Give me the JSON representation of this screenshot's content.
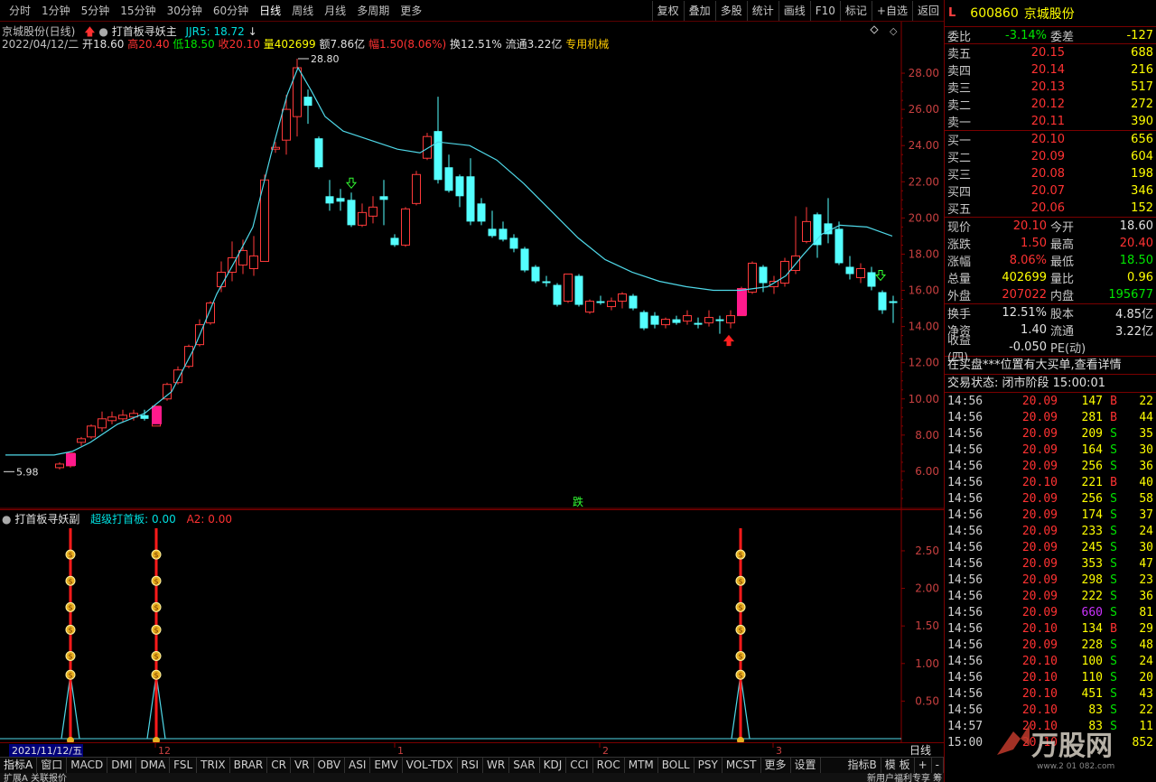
{
  "toolbar": {
    "periods": [
      "分时",
      "1分钟",
      "5分钟",
      "15分钟",
      "30分钟",
      "60分钟",
      "日线",
      "周线",
      "月线",
      "多周期",
      "更多"
    ],
    "active_period": "日线",
    "right_tools": [
      "复权",
      "叠加",
      "多股",
      "统计",
      "画线",
      "F10",
      "标记",
      "+自选",
      "返回"
    ]
  },
  "chart_header": {
    "stock_label": "京城股份(日线)",
    "indicator_name": "打首板寻妖主",
    "jjr5": "JJR5: 18.72",
    "date": "2022/04/12/二",
    "open": "开18.60",
    "high": "高20.40",
    "low": "低18.50",
    "close": "收20.10",
    "volume": "量402699",
    "amount": "额7.86亿",
    "change_pct": "幅1.50(8.06%)",
    "turnover": "换12.51%",
    "float_cap": "流通3.22亿",
    "sector": "专用机械"
  },
  "main_chart": {
    "y_ticks": [
      "28.00",
      "26.00",
      "24.00",
      "22.00",
      "20.00",
      "18.00",
      "16.00",
      "14.00",
      "12.00",
      "10.00",
      "8.00",
      "6.00"
    ],
    "peak_label": "28.80",
    "low_label": "5.98",
    "annotation": "跌"
  },
  "sub_chart": {
    "title": "打首板寻妖副",
    "series1": "超级打首板: 0.00",
    "series2": "A2: 0.00",
    "y_ticks": [
      "2.50",
      "2.00",
      "1.50",
      "1.00",
      "0.50"
    ]
  },
  "x_axis": {
    "cursor_date": "2021/11/12/五",
    "labels": [
      "12",
      "1",
      "2",
      "3"
    ],
    "period_label": "日线"
  },
  "indicator_tabs": [
    "指标A",
    "窗口",
    "MACD",
    "DMI",
    "DMA",
    "FSL",
    "TRIX",
    "BRAR",
    "CR",
    "VR",
    "OBV",
    "ASI",
    "EMV",
    "VOL-TDX",
    "RSI",
    "WR",
    "SAR",
    "KDJ",
    "CCI",
    "ROC",
    "MTM",
    "BOLL",
    "PSY",
    "MCST",
    "更多",
    "设置"
  ],
  "indicator_tabs_right": [
    "指标B",
    "模 板",
    "+",
    "-"
  ],
  "bottom_bar": {
    "left": "扩展A  关联报价",
    "right": "新用户福利专享  筹  价  细  势  联  值  主"
  },
  "quote": {
    "flag": "L",
    "code": "600860",
    "name": "京城股份",
    "webi_label": "委比",
    "webi_value": "-3.14%",
    "weicha_label": "委差",
    "weicha_value": "-127",
    "asks": [
      {
        "label": "卖五",
        "price": "20.15",
        "vol": "688"
      },
      {
        "label": "卖四",
        "price": "20.14",
        "vol": "216"
      },
      {
        "label": "卖三",
        "price": "20.13",
        "vol": "517"
      },
      {
        "label": "卖二",
        "price": "20.12",
        "vol": "272"
      },
      {
        "label": "卖一",
        "price": "20.11",
        "vol": "390"
      }
    ],
    "bids": [
      {
        "label": "买一",
        "price": "20.10",
        "vol": "656"
      },
      {
        "label": "买二",
        "price": "20.09",
        "vol": "604"
      },
      {
        "label": "买三",
        "price": "20.08",
        "vol": "198"
      },
      {
        "label": "买四",
        "price": "20.07",
        "vol": "346"
      },
      {
        "label": "买五",
        "price": "20.06",
        "vol": "152"
      }
    ],
    "stats1": [
      {
        "k1": "现价",
        "v1": "20.10",
        "c1": "red",
        "k2": "今开",
        "v2": "18.60",
        "c2": "white"
      },
      {
        "k1": "涨跌",
        "v1": "1.50",
        "c1": "red",
        "k2": "最高",
        "v2": "20.40",
        "c2": "red"
      },
      {
        "k1": "涨幅",
        "v1": "8.06%",
        "c1": "red",
        "k2": "最低",
        "v2": "18.50",
        "c2": "green"
      },
      {
        "k1": "总量",
        "v1": "402699",
        "c1": "yellow",
        "k2": "量比",
        "v2": "0.96",
        "c2": "yellow"
      },
      {
        "k1": "外盘",
        "v1": "207022",
        "c1": "red",
        "k2": "内盘",
        "v2": "195677",
        "c2": "green"
      }
    ],
    "stats2": [
      {
        "k1": "换手",
        "v1": "12.51%",
        "c1": "white",
        "k2": "股本",
        "v2": "4.85亿",
        "c2": "white"
      },
      {
        "k1": "净资",
        "v1": "1.40",
        "c1": "white",
        "k2": "流通",
        "v2": "3.22亿",
        "c2": "white"
      },
      {
        "k1": "收益(四)",
        "v1": "-0.050",
        "c1": "white",
        "k2": "PE(动)",
        "v2": "",
        "c2": "white"
      }
    ],
    "message": "在买盘***位置有大买单,查看详情",
    "status": "交易状态: 闭市阶段 15:00:01",
    "ticks": [
      {
        "t": "14:56",
        "p": "20.09",
        "v": "147",
        "d": "B",
        "n": "22"
      },
      {
        "t": "14:56",
        "p": "20.09",
        "v": "281",
        "d": "B",
        "n": "44"
      },
      {
        "t": "14:56",
        "p": "20.09",
        "v": "209",
        "d": "S",
        "n": "35"
      },
      {
        "t": "14:56",
        "p": "20.09",
        "v": "164",
        "d": "S",
        "n": "30"
      },
      {
        "t": "14:56",
        "p": "20.09",
        "v": "256",
        "d": "S",
        "n": "36"
      },
      {
        "t": "14:56",
        "p": "20.10",
        "v": "221",
        "d": "B",
        "n": "40"
      },
      {
        "t": "14:56",
        "p": "20.09",
        "v": "256",
        "d": "S",
        "n": "58"
      },
      {
        "t": "14:56",
        "p": "20.09",
        "v": "174",
        "d": "S",
        "n": "37"
      },
      {
        "t": "14:56",
        "p": "20.09",
        "v": "233",
        "d": "S",
        "n": "24"
      },
      {
        "t": "14:56",
        "p": "20.09",
        "v": "245",
        "d": "S",
        "n": "30"
      },
      {
        "t": "14:56",
        "p": "20.09",
        "v": "353",
        "d": "S",
        "n": "47"
      },
      {
        "t": "14:56",
        "p": "20.09",
        "v": "298",
        "d": "S",
        "n": "23"
      },
      {
        "t": "14:56",
        "p": "20.09",
        "v": "222",
        "d": "S",
        "n": "36"
      },
      {
        "t": "14:56",
        "p": "20.09",
        "v": "660",
        "d": "S",
        "n": "81"
      },
      {
        "t": "14:56",
        "p": "20.10",
        "v": "134",
        "d": "B",
        "n": "29"
      },
      {
        "t": "14:56",
        "p": "20.09",
        "v": "228",
        "d": "S",
        "n": "48"
      },
      {
        "t": "14:56",
        "p": "20.10",
        "v": "100",
        "d": "S",
        "n": "24"
      },
      {
        "t": "14:56",
        "p": "20.10",
        "v": "110",
        "d": "S",
        "n": "20"
      },
      {
        "t": "14:56",
        "p": "20.10",
        "v": "451",
        "d": "S",
        "n": "43"
      },
      {
        "t": "14:56",
        "p": "20.10",
        "v": "83",
        "d": "S",
        "n": "22"
      },
      {
        "t": "14:57",
        "p": "20.10",
        "v": "83",
        "d": "S",
        "n": "11"
      },
      {
        "t": "15:00",
        "p": "20.10",
        "v": "",
        "d": "",
        "n": "852"
      }
    ]
  },
  "watermark": "万股网"
}
